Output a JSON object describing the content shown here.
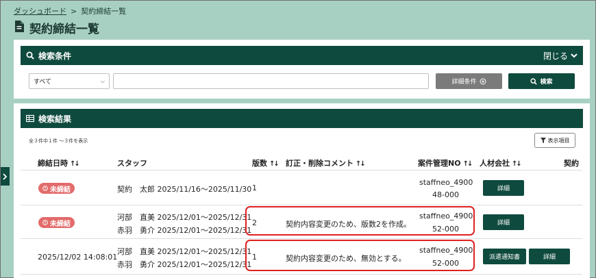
{
  "breadcrumb": {
    "home": "ダッシュボード",
    "separator": ">",
    "current": "契約締結一覧"
  },
  "page": {
    "title": "契約締結一覧",
    "title_icon": "document-icon"
  },
  "search": {
    "header": "検索条件",
    "close_label": "閉じる",
    "select_value": "すべて",
    "keyword_value": "",
    "detail_button": "詳細条件",
    "search_button": "検索"
  },
  "results": {
    "header": "検索結果",
    "count_text": "全３件中１件 〜３件を表示",
    "display_items_button": "表示項目",
    "columns": {
      "date": "締結日時",
      "staff": "スタッフ",
      "version": "版数",
      "comment": "訂正・削除コメント",
      "case_no": "案件管理NO",
      "company": "人材会社",
      "last": "契約"
    },
    "rows": [
      {
        "status": "未締結",
        "staff": [
          "契約　太郎 2025/11/16〜2025/11/30"
        ],
        "version": "1",
        "comment": "",
        "case_no_1": "staffneo_4900",
        "case_no_2": "48-000",
        "buttons": [
          "詳細"
        ]
      },
      {
        "status": "未締結",
        "staff": [
          "河部　直美 2025/12/01〜2025/12/31",
          "赤羽　勇介 2025/12/01〜2025/12/31"
        ],
        "version": "2",
        "comment": "契約内容変更のため、版数2を作成。",
        "case_no_1": "staffneo_4900",
        "case_no_2": "52-000",
        "buttons": [
          "詳細"
        ]
      },
      {
        "date": "2025/12/02 14:08:01",
        "staff": [
          "河部　直美 2025/12/01〜2025/12/31",
          "赤羽　勇介 2025/12/01〜2025/12/31"
        ],
        "version": "1",
        "comment": "契約内容変更のため、無効とする。",
        "case_no_1": "staffneo_4900",
        "case_no_2": "52-000",
        "buttons": [
          "派遣通知書",
          "詳細"
        ]
      }
    ]
  },
  "colors": {
    "primary": "#0f4a3e",
    "background": "#a8d0c2",
    "badge": "#e36b6b",
    "highlight": "#e02020"
  }
}
